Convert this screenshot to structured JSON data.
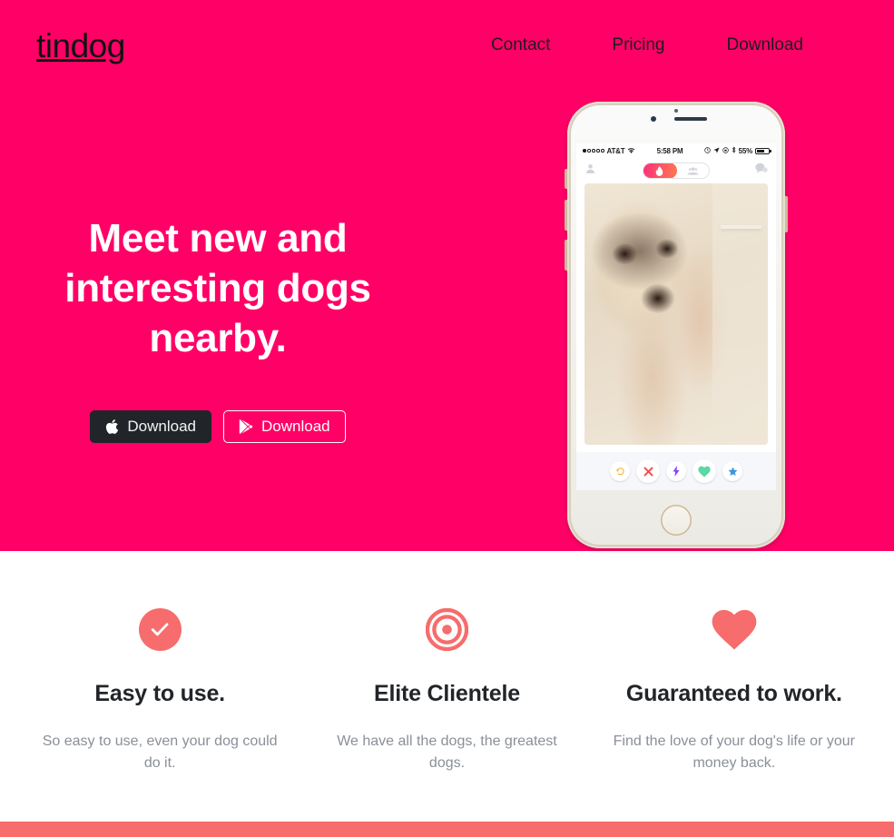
{
  "brand": {
    "name": "tindog"
  },
  "nav": {
    "links": [
      {
        "label": "Contact"
      },
      {
        "label": "Pricing"
      },
      {
        "label": "Download"
      }
    ]
  },
  "hero": {
    "title": "Meet new and interesting dogs nearby.",
    "buttons": [
      {
        "label": "Download",
        "icon": "apple-icon",
        "style": "filled-dark"
      },
      {
        "label": "Download",
        "icon": "google-play-icon",
        "style": "outline-white"
      }
    ],
    "background_color": "#ff0066"
  },
  "phone": {
    "statusbar": {
      "carrier": "AT&T",
      "time": "5:58 PM",
      "battery_percent": "55%",
      "icons": [
        "signal-dots-icon",
        "wifi-icon",
        "alarm-icon",
        "location-icon",
        "rotation-lock-icon",
        "bluetooth-icon",
        "battery-icon"
      ]
    },
    "appbar": {
      "left_icon": "profile-icon",
      "toggle_active_icon": "flame-icon",
      "toggle_inactive_icon": "people-icon",
      "right_icon": "chat-icon"
    },
    "card": {
      "alt": "dog-photo"
    },
    "actions": [
      {
        "name": "rewind-button",
        "icon": "rewind-icon",
        "color": "#f5b731"
      },
      {
        "name": "nope-button",
        "icon": "x-icon",
        "color": "#ec4b4b"
      },
      {
        "name": "boost-button",
        "icon": "lightning-icon",
        "color": "#8a3ffc"
      },
      {
        "name": "like-button",
        "icon": "heart-icon",
        "color": "#59d9a5"
      },
      {
        "name": "superlike-button",
        "icon": "star-icon",
        "color": "#3f97e0"
      }
    ]
  },
  "features": [
    {
      "icon": "check-circle-icon",
      "icon_color": "#f76c6c",
      "title": "Easy to use.",
      "text": "So easy to use, even your dog could do it."
    },
    {
      "icon": "bullseye-icon",
      "icon_color": "#f76c6c",
      "title": "Elite Clientele",
      "text": "We have all the dogs, the greatest dogs."
    },
    {
      "icon": "heart-icon",
      "icon_color": "#f76c6c",
      "title": "Guaranteed to work.",
      "text": "Find the love of your dog's life or your money back."
    }
  ],
  "next_section": {
    "background_color": "#f76c6c"
  }
}
